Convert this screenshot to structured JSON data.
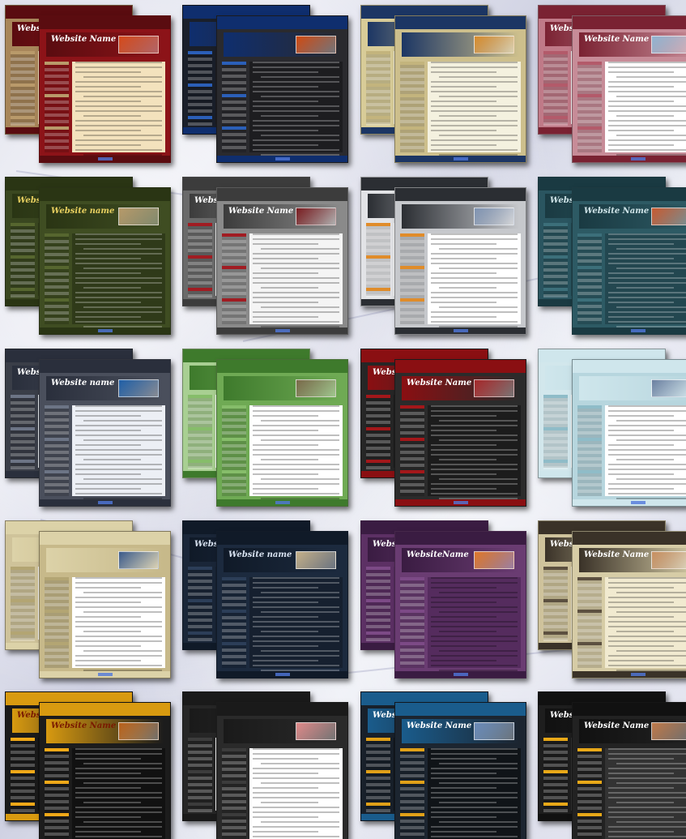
{
  "gallery": {
    "templates": [
      {
        "title": "Website Name",
        "bg": "#8c1318",
        "panel": "#f3e2bd",
        "side": "#b99a6a",
        "hdr": "#5a0c10",
        "photo": "#d64a1a",
        "text": "#ffffff",
        "back": "#a8865a"
      },
      {
        "title": "",
        "bg": "#2a2a2e",
        "panel": "#1d1d20",
        "side": "#2b5fb8",
        "hdr": "#0f2e6e",
        "photo": "#d04a10",
        "text": "#ffffff",
        "back": "#1a1f2a"
      },
      {
        "title": "",
        "bg": "#cdbf8c",
        "panel": "#f4f1df",
        "side": "#c3b47d",
        "hdr": "#1c3664",
        "photo": "#d88b2a",
        "text": "#ffffff",
        "back": "#d8cc98"
      },
      {
        "title": "Website Name",
        "bg": "#c78c98",
        "panel": "#ffffff",
        "side": "#b35a6a",
        "hdr": "#7a2232",
        "photo": "#8fb4d2",
        "text": "#ffffff",
        "back": "#c07a88"
      },
      {
        "title": "Website name",
        "bg": "#3f4d22",
        "panel": "#2f3a19",
        "side": "#56662f",
        "hdr": "#2a3514",
        "photo": "#b79a6a",
        "text": "#e8d060",
        "back": "#3a4720"
      },
      {
        "title": "Website Name",
        "bg": "#8a8a8a",
        "panel": "#f4f4f4",
        "side": "#a11c22",
        "hdr": "#3c3c3c",
        "photo": "#7a1c20",
        "text": "#ffffff",
        "back": "#6a6a6a"
      },
      {
        "title": "",
        "bg": "#c6c8cc",
        "panel": "#ffffff",
        "side": "#e08c2a",
        "hdr": "#2b2e33",
        "photo": "#7f93b2",
        "text": "#ffffff",
        "back": "#e2e3e6"
      },
      {
        "title": "Website Name",
        "bg": "#2d5a64",
        "panel": "#234750",
        "side": "#3c6f7a",
        "hdr": "#1a3a42",
        "photo": "#c85a30",
        "text": "#cfe4e8",
        "back": "#2a5560"
      },
      {
        "title": "Website name",
        "bg": "#4a4f5c",
        "panel": "#eceff5",
        "side": "#6c7485",
        "hdr": "#2a2f3c",
        "photo": "#2060a8",
        "text": "#ffffff",
        "back": "#3a3e48"
      },
      {
        "title": "",
        "bg": "#6faa54",
        "panel": "#ffffff",
        "side": "#86bd6a",
        "hdr": "#3e7a2c",
        "photo": "#7a6a4a",
        "text": "#ffffff",
        "back": "#a8cf92"
      },
      {
        "title": "Website Name",
        "bg": "#2b2b2b",
        "panel": "#1c1c1c",
        "side": "#a3171a",
        "hdr": "#8a0f12",
        "photo": "#a4282a",
        "text": "#ffffff",
        "back": "#262626"
      },
      {
        "title": "",
        "bg": "#b7d6de",
        "panel": "#ffffff",
        "side": "#8fbcc8",
        "hdr": "#cfe6ec",
        "photo": "#6a7fa0",
        "text": "#2a4a60",
        "back": "#d2e7ec"
      },
      {
        "title": "",
        "bg": "#c7b98a",
        "panel": "#ffffff",
        "side": "#b3a573",
        "hdr": "#dcd2a8",
        "photo": "#3a5a8a",
        "text": "#6a5a30",
        "back": "#cfc39a"
      },
      {
        "title": "Website name",
        "bg": "#1c2a3e",
        "panel": "#16202f",
        "side": "#2c3e58",
        "hdr": "#101a28",
        "photo": "#c4b08a",
        "text": "#d8e2f0",
        "back": "#1a2638"
      },
      {
        "title": "WebsiteName",
        "bg": "#6a3c72",
        "panel": "#552c5e",
        "side": "#7c4a86",
        "hdr": "#3a1c42",
        "photo": "#e0782a",
        "text": "#ffffff",
        "back": "#5c3064"
      },
      {
        "title": "Website Name",
        "bg": "#d6cca6",
        "panel": "#f1ead0",
        "side": "#5c5040",
        "hdr": "#3a3228",
        "photo": "#c89060",
        "text": "#ffffff",
        "back": "#cfc39c"
      },
      {
        "title": "Website Name",
        "bg": "#1c1c1c",
        "panel": "#111111",
        "side": "#f0a818",
        "hdr": "#d89a10",
        "photo": "#b8601a",
        "text": "#7a1a00",
        "back": "#1a1a1a"
      },
      {
        "title": "",
        "bg": "#2a2a2a",
        "panel": "#ffffff",
        "side": "#3c3c3c",
        "hdr": "#1a1a1a",
        "photo": "#e08a8a",
        "text": "#ffffff",
        "back": "#262626"
      },
      {
        "title": "Website Name",
        "bg": "#1c2530",
        "panel": "#101418",
        "side": "#e0a018",
        "hdr": "#1a5c8c",
        "photo": "#6a8ab8",
        "text": "#ffffff",
        "back": "#18202a"
      },
      {
        "title": "Website Name",
        "bg": "#222222",
        "panel": "#333333",
        "side": "#e8a818",
        "hdr": "#111111",
        "photo": "#c07a4a",
        "text": "#ffffff",
        "back": "#1e1e1e"
      }
    ]
  }
}
